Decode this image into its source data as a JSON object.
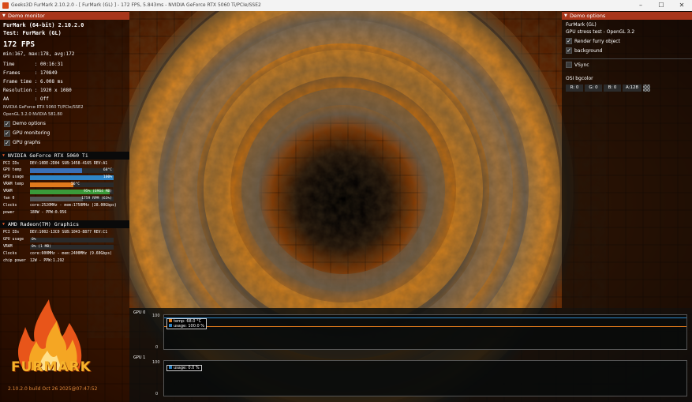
{
  "titlebar": {
    "text": "Geeks3D FurMark 2.10.2.0 - [ FurMark (GL) ] - 172 FPS, 5.843ms - NVIDIA GeForce RTX 5060 Ti/PCIe/SSE2",
    "minimize": "–",
    "maximize": "☐",
    "close": "✕"
  },
  "demo_monitor": {
    "header": "Demo monitor",
    "app": "FurMark (64-bit) 2.10.2.0",
    "test": "Test: FurMark (GL)",
    "fps": "172 FPS",
    "fps_stats": "min:167, max:178, avg:172",
    "stats": [
      {
        "label": "Time      ",
        "value": ": 00:16:31"
      },
      {
        "label": "Frames    ",
        "value": ": 170849"
      },
      {
        "label": "Frame time",
        "value": ": 6.008 ms"
      },
      {
        "label": "Resolution",
        "value": ": 1920 x 1080"
      },
      {
        "label": "AA        ",
        "value": ": Off"
      }
    ],
    "renderer": "NVIDIA GeForce RTX 5060 Ti/PCIe/SSE2",
    "gl": "OpenGL 3.2.0 NVIDIA 581.80",
    "options": [
      {
        "label": "Demo options",
        "checked": true
      },
      {
        "label": "GPU monitoring",
        "checked": true
      },
      {
        "label": "GPU graphs",
        "checked": true
      }
    ]
  },
  "gpu0": {
    "header": "NVIDIA GeForce RTX 5060 Ti",
    "pci_label": "PCI IDs",
    "pci": "DEV:10DE-2D04 SUB:1458-4165 REV:A1",
    "bars": [
      {
        "label": "GPU temp",
        "text": "68°C",
        "pct": 62,
        "color": "#3b6fb6"
      },
      {
        "label": "GPU usage",
        "text": "100%",
        "pct": 100,
        "color": "#2f86c8"
      },
      {
        "label": "VRAM temp",
        "text": "56°C",
        "pct": 52,
        "color": "#e07a1c"
      },
      {
        "label": "VRAM",
        "text": "95% (6964 MB)",
        "pct": 95,
        "color": "#3a9a3a"
      },
      {
        "label": "fan 0",
        "text": "1759 RPM (63%)",
        "pct": 63,
        "color": "#555555"
      }
    ],
    "clocks_label": "Clocks",
    "clocks": "core:2520MHz - mem:1750MHz (28.00Gbps)",
    "power_label": "power",
    "power": "180W - PPW:0.956"
  },
  "gpu1": {
    "header": "AMD Radeon(TM) Graphics",
    "pci_label": "PCI IDs",
    "pci": "DEV:1002-13C0 SUB:1043-8877 REV:C1",
    "bars": [
      {
        "label": "GPU usage",
        "text": "0%",
        "pct": 0,
        "color": "#2f86c8"
      },
      {
        "label": "VRAM",
        "text": "0% (1 MB)",
        "pct": 0,
        "color": "#3a9a3a"
      }
    ],
    "clocks_label": "Clocks",
    "clocks": "core:600MHz - mem:2400MHz (9.60Gbps)",
    "power_label": "chip power",
    "power": "12W - PPW:1.292"
  },
  "logo": {
    "text": "FURMARK",
    "build": "2.10.2.0 build Oct 26 2025@07:47:52"
  },
  "demo_options": {
    "header": "Demo options",
    "title": "FurMark (GL)",
    "subtitle": "GPU stress test - OpenGL 3.2",
    "checks": [
      {
        "label": "Render furry object",
        "checked": true
      },
      {
        "label": "background",
        "checked": true
      },
      {
        "label": "VSync",
        "checked": false
      }
    ],
    "osi_label": "OSI bgcolor",
    "osi": [
      {
        "label": "R: 0"
      },
      {
        "label": "G: 0"
      },
      {
        "label": "B: 0"
      },
      {
        "label": "A:128"
      }
    ]
  },
  "graphs": [
    {
      "tag": "GPU 0",
      "top": "100",
      "bottom": "0",
      "legend": [
        {
          "text": "temp: 68.0 °C",
          "color": "#e07a1c"
        },
        {
          "text": "usage: 100.0 %",
          "color": "#2f86c8"
        }
      ]
    },
    {
      "tag": "GPU 1",
      "top": "100",
      "bottom": "0",
      "legend": [
        {
          "text": "usage: 0.0 %",
          "color": "#2f86c8"
        }
      ]
    }
  ],
  "colors": {
    "header": "#a8361b",
    "accent": "#e45a2a"
  }
}
